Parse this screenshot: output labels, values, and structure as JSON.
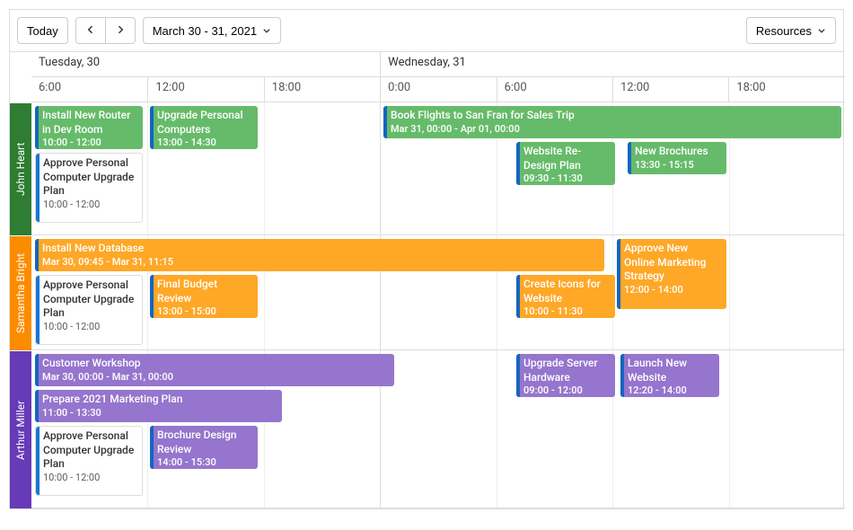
{
  "toolbar": {
    "today_label": "Today",
    "range_label": "March 30 - 31, 2021",
    "resources_label": "Resources"
  },
  "days": [
    {
      "label": "Tuesday, 30"
    },
    {
      "label": "Wednesday, 31"
    }
  ],
  "time_slots_day1": [
    "6:00",
    "12:00",
    "18:00"
  ],
  "time_slots_day2": [
    "0:00",
    "6:00",
    "12:00",
    "18:00"
  ],
  "resources": {
    "john": {
      "label": "John Heart",
      "color": "#2e7d32"
    },
    "samantha": {
      "label": "Samantha Bright",
      "color": "#fb8c00"
    },
    "arthur": {
      "label": "Arthur Miller",
      "color": "#673ab7"
    }
  },
  "appointments": {
    "john": [
      {
        "title": "Install New Router in Dev Room",
        "time": "10:00 - 12:00",
        "color": "green"
      },
      {
        "title": "Upgrade Personal Computers",
        "time": "13:00 - 14:30",
        "color": "green"
      },
      {
        "title": "Approve Personal Computer Upgrade Plan",
        "time": "10:00 - 12:00",
        "color": "white"
      },
      {
        "title": "Book Flights to San Fran for Sales Trip",
        "time": "Mar 31, 00:00 - Apr 01, 00:00",
        "color": "green"
      },
      {
        "title": "Website Re-Design Plan",
        "time": "09:30 - 11:30",
        "color": "green"
      },
      {
        "title": "New Brochures",
        "time": "13:30 - 15:15",
        "color": "green"
      }
    ],
    "samantha": [
      {
        "title": "Install New Database",
        "time": "Mar 30, 09:45 - Mar 31, 11:15",
        "color": "orange"
      },
      {
        "title": "Approve New Online Marketing Strategy",
        "time": "12:00 - 14:00",
        "color": "orange"
      },
      {
        "title": "Approve Personal Computer Upgrade Plan",
        "time": "10:00 - 12:00",
        "color": "white"
      },
      {
        "title": "Final Budget Review",
        "time": "13:00 - 15:00",
        "color": "orange"
      },
      {
        "title": "Create Icons for Website",
        "time": "10:00 - 11:30",
        "color": "orange"
      }
    ],
    "arthur": [
      {
        "title": "Customer Workshop",
        "time": "Mar 30, 00:00 - Mar 31, 00:00",
        "color": "purple"
      },
      {
        "title": "Upgrade Server Hardware",
        "time": "09:00 - 12:00",
        "color": "purple"
      },
      {
        "title": "Launch New Website",
        "time": "12:20 - 14:00",
        "color": "purple"
      },
      {
        "title": "Prepare 2021 Marketing Plan",
        "time": "11:00 - 13:30",
        "color": "purple"
      },
      {
        "title": "Approve Personal Computer Upgrade Plan",
        "time": "10:00 - 12:00",
        "color": "white"
      },
      {
        "title": "Brochure Design Review",
        "time": "14:00 - 15:30",
        "color": "purple"
      }
    ]
  }
}
